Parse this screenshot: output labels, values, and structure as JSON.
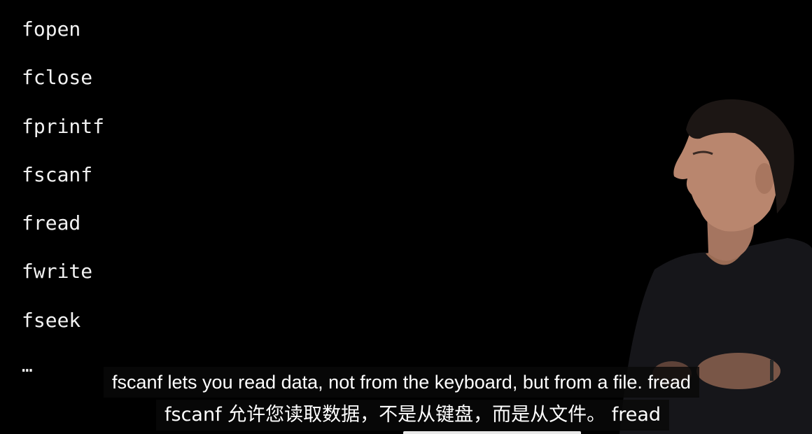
{
  "slide": {
    "functions": [
      "fopen",
      "fclose",
      "fprintf",
      "fscanf",
      "fread",
      "fwrite",
      "fseek"
    ],
    "ellipsis": "…"
  },
  "captions": {
    "english": "fscanf lets you read data, not from the keyboard, but from a file. fread",
    "chinese": "fscanf 允许您读取数据，不是从键盘，而是从文件。  fread"
  },
  "colors": {
    "background": "#000000",
    "slide_text": "#f2f2f2",
    "caption_text": "#ffffff",
    "shirt": "#16161a"
  }
}
